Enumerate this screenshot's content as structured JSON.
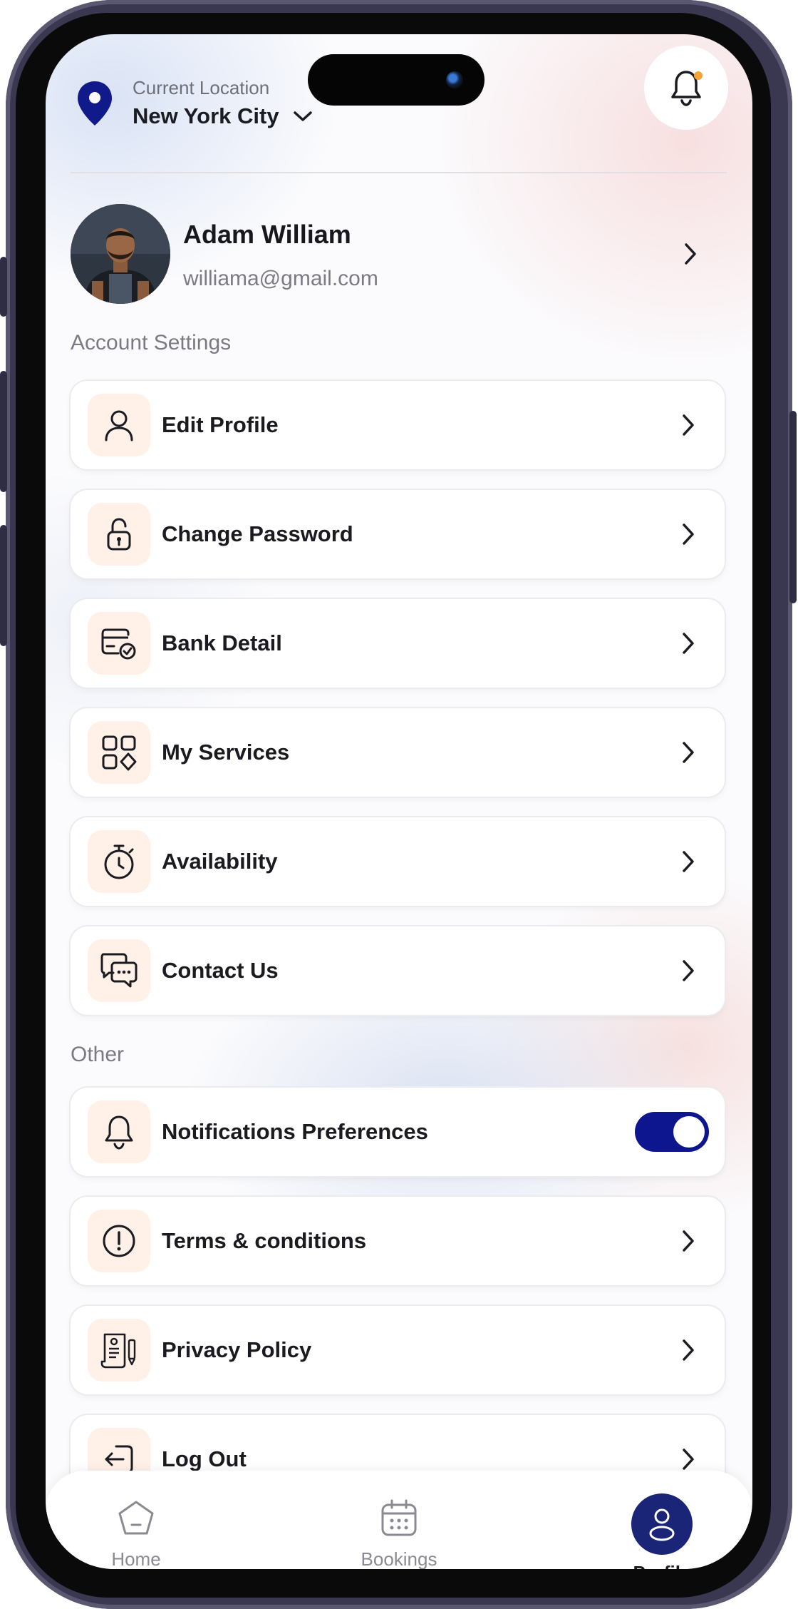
{
  "header": {
    "location_label": "Current Location",
    "location_value": "New York City"
  },
  "profile": {
    "name": "Adam William",
    "email": "williama@gmail.com"
  },
  "account_settings": {
    "title": "Account Settings",
    "items": [
      {
        "label": "Edit Profile",
        "icon": "user-icon"
      },
      {
        "label": "Change Password",
        "icon": "lock-icon"
      },
      {
        "label": "Bank Detail",
        "icon": "card-check-icon"
      },
      {
        "label": "My Services",
        "icon": "services-grid-icon"
      },
      {
        "label": "Availability",
        "icon": "stopwatch-icon"
      },
      {
        "label": "Contact Us",
        "icon": "chat-bubbles-icon"
      }
    ]
  },
  "other": {
    "title": "Other",
    "items": [
      {
        "label": "Notifications Preferences",
        "icon": "bell-icon",
        "toggle_on": true
      },
      {
        "label": "Terms & conditions",
        "icon": "alert-circle-icon"
      },
      {
        "label": "Privacy Policy",
        "icon": "document-icon"
      },
      {
        "label": "Log Out",
        "icon": "logout-icon"
      }
    ]
  },
  "tabbar": {
    "tabs": [
      {
        "label": "Home",
        "icon": "home-icon",
        "active": false
      },
      {
        "label": "Bookings",
        "icon": "calendar-icon",
        "active": false
      },
      {
        "label": "Profile",
        "icon": "profile-icon",
        "active": true
      }
    ]
  },
  "colors": {
    "accent": "#0d168e",
    "icon_bg": "#fff1e8",
    "notification_dot": "#f5a23a"
  }
}
